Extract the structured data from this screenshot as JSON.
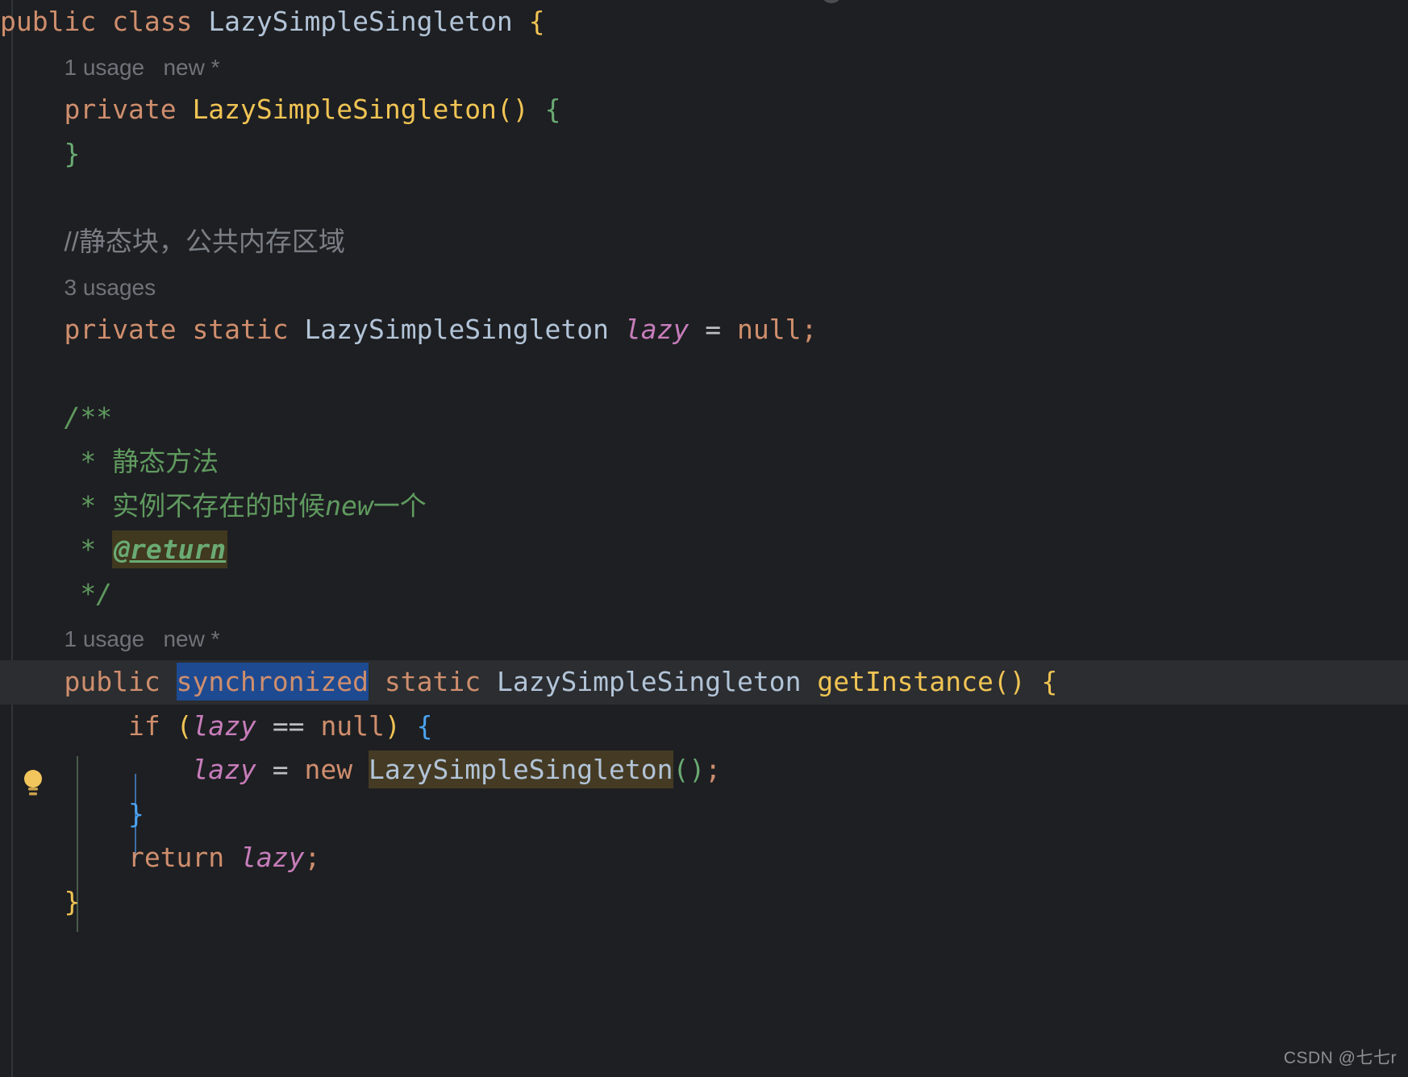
{
  "editor": {
    "theme_bg": "#1e1f22",
    "caret_line_bg": "#2b2d30",
    "selection_color": "#1e4a91",
    "identifier_highlight_color": "#453b24",
    "default_text_color": "#bcbec4",
    "keyword_color": "#cf8e6d",
    "class_color": "#b2c4d8",
    "method_color": "#f0c454",
    "field_color": "#c77dbb",
    "javadoc_color": "#5f9a5f",
    "comment_color": "#7a7e85",
    "hint_color": "#6f737a",
    "language": "Java"
  },
  "icons": {
    "intention_bulb": "lightbulb-icon",
    "top_marker": "breadcrumb-marker-icon"
  },
  "code": {
    "line_1": {
      "kw_public": "public",
      "kw_class": "class",
      "class_name": "LazySimpleSingleton",
      "brace": "{"
    },
    "line_2_hint": "1 usage   new *",
    "line_3": {
      "kw_private": "private",
      "ctor_name": "LazySimpleSingleton",
      "parens": "()",
      "brace": "{"
    },
    "line_4_close": "}",
    "line_6_comment": "//静态块，公共内存区域",
    "line_7_hint": "3 usages",
    "line_8": {
      "kw_private": "private",
      "kw_static": "static",
      "class_name": "LazySimpleSingleton",
      "field": "lazy",
      "assign": "=",
      "kw_null": "null",
      "semi": ";"
    },
    "javadoc": {
      "open": "/**",
      "star": "*",
      "line_1": "静态方法",
      "line_2_pre": "实例不存在的时候",
      "line_2_it": "new",
      "line_2_post": "一个",
      "tag_return": "@return",
      "close": "*/"
    },
    "line_15_hint": "1 usage   new *",
    "line_16": {
      "kw_public": "public",
      "kw_synchronized": "synchronized",
      "kw_static": "static",
      "return_type": "LazySimpleSingleton",
      "method_name": "getInstance",
      "parens": "()",
      "brace": "{"
    },
    "line_17": {
      "kw_if": "if",
      "lparen": "(",
      "field": "lazy",
      "eq": "==",
      "kw_null": "null",
      "rparen": ")",
      "brace": "{"
    },
    "line_18": {
      "field": "lazy",
      "assign": "=",
      "kw_new": "new",
      "class_name": "LazySimpleSingleton",
      "parens": "()",
      "semi": ";"
    },
    "line_19_close": "}",
    "line_20": {
      "kw_return": "return",
      "field": "lazy",
      "semi": ";"
    },
    "line_21_close": "}"
  },
  "watermark": {
    "text": "CSDN @七七r"
  }
}
